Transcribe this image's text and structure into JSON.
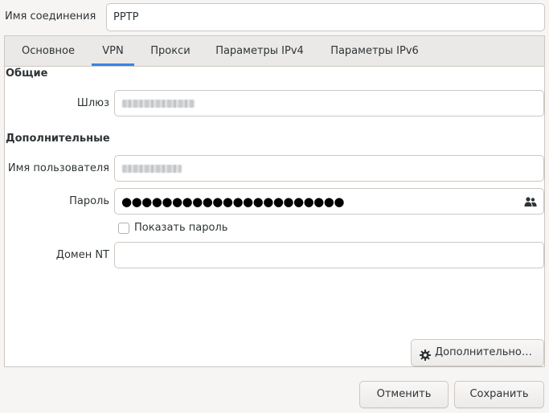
{
  "connection": {
    "name_label": "Имя соединения",
    "name_value": "PPTP"
  },
  "tabs": [
    {
      "label": "Основное",
      "active": false
    },
    {
      "label": "VPN",
      "active": true
    },
    {
      "label": "Прокси",
      "active": false
    },
    {
      "label": "Параметры IPv4",
      "active": false
    },
    {
      "label": "Параметры IPv6",
      "active": false
    }
  ],
  "general": {
    "section_title": "Общие",
    "gateway_label": "Шлюз"
  },
  "advanced": {
    "section_title": "Дополнительные",
    "username_label": "Имя пользователя",
    "password_label": "Пароль",
    "password_mask": "●●●●●●●●●●●●●●●●●●●●●●",
    "password_icon": "user-group-icon",
    "show_password_label": "Показать пароль",
    "show_password_checked": false,
    "nt_domain_label": "Домен NT",
    "nt_domain_value": "",
    "advanced_button_label": "Дополнительно…",
    "advanced_button_icon": "gear-icon"
  },
  "footer": {
    "cancel_label": "Отменить",
    "save_label": "Сохранить"
  },
  "colors": {
    "accent": "#3584e4",
    "background": "#f6f5f4",
    "border": "#cdc7c2"
  }
}
